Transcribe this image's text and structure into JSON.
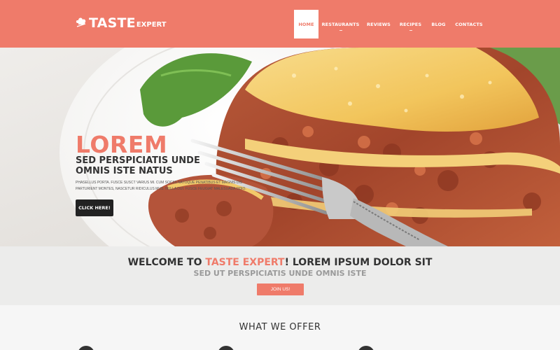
{
  "header": {
    "logo_main": "TASTE",
    "logo_sub": "EXPERT",
    "logo_icon": "chef-hat-icon",
    "nav": [
      {
        "label": "HOME",
        "active": true
      },
      {
        "label": "RESTAURANTS",
        "active": false
      },
      {
        "label": "REVIEWS",
        "active": false
      },
      {
        "label": "RECIPES",
        "active": false
      },
      {
        "label": "BLOG",
        "active": false
      },
      {
        "label": "CONTACTS",
        "active": false
      }
    ]
  },
  "hero": {
    "title": "LOREM",
    "subtitle": "SED PERSPICIATIS UNDE OMNIS ISTE NATUS",
    "text": "PHASELLUS PORTA. FUSCE SUSCT VARIUS MI. CUM SOCIIS NATOQUE PENATIBUS ET MAGNIS DIS PARTURIENT MONTES, NASCETUR RIDICULUS MUS. NULLA DUI. FUSCE FEUGIAT MALESUADA ODIO.",
    "button": "CLICK HERE!"
  },
  "welcome": {
    "title_pre": "WELCOME TO ",
    "title_accent": "TASTE EXPERT",
    "title_post": "! LOREM IPSUM DOLOR SIT",
    "subtitle": "SED UT PERSPICIATIS UNDE OMNIS ISTE",
    "button": "JOIN US!"
  },
  "offer": {
    "title": "WHAT WE OFFER"
  },
  "colors": {
    "accent": "#ef7b6a",
    "dark": "#222222"
  }
}
